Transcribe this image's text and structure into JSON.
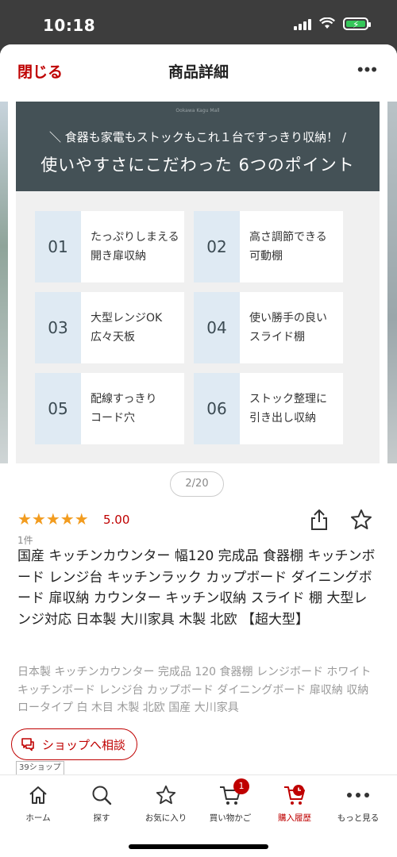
{
  "status": {
    "time": "10:18"
  },
  "nav": {
    "close": "閉じる",
    "title": "商品詳細",
    "more": "•••"
  },
  "slide": {
    "brand": "Ookawa Kagu Mall",
    "sub": "＼ 食器も家電もストックもこれ１台ですっきり収納！ /",
    "headline": "使いやすさにこだわった 6つのポイント",
    "points": [
      {
        "num": "01",
        "label": "たっぷりしまえる\n開き扉収納"
      },
      {
        "num": "02",
        "label": "高さ調節できる\n可動棚"
      },
      {
        "num": "03",
        "label": "大型レンジOK\n広々天板"
      },
      {
        "num": "04",
        "label": "使い勝手の良い\nスライド棚"
      },
      {
        "num": "05",
        "label": "配線すっきり\nコード穴"
      },
      {
        "num": "06",
        "label": "ストック整理に\n引き出し収納"
      }
    ]
  },
  "pager": "2/20",
  "product": {
    "stars": "★★★★★",
    "rating_value": 5.0,
    "score": "5.00",
    "review_count": "1件",
    "title": "国産 キッチンカウンター 幅120 完成品 食器棚 キッチンボード レンジ台 キッチンラック カップボード ダイニングボード 扉収納 カウンター キッチン収納 スライド 棚 大型レンジ対応 日本製 大川家具 木製 北欧 【超大型】",
    "description": "日本製 キッチンカウンター 完成品 120 食器棚 レンジボード ホワイト キッチンボード レンジ台 カップボード ダイニングボード 扉収納 収納 ロータイプ 白 木目 木製 北欧 国産 大川家具"
  },
  "shop": {
    "consult": "ショップへ相談",
    "count": "39ショップ"
  },
  "tabs": [
    {
      "label": "ホーム",
      "icon": "home-icon"
    },
    {
      "label": "探す",
      "icon": "search-icon"
    },
    {
      "label": "お気に入り",
      "icon": "star-icon"
    },
    {
      "label": "買い物かご",
      "icon": "cart-icon",
      "badge": "1"
    },
    {
      "label": "購入履歴",
      "icon": "purchase-history-icon"
    },
    {
      "label": "もっと見る",
      "icon": "more-icon"
    }
  ],
  "colors": {
    "accent": "#bf0000",
    "star": "#f29c1f",
    "slide_header": "#445156",
    "point_bg": "#dfeaf3"
  }
}
